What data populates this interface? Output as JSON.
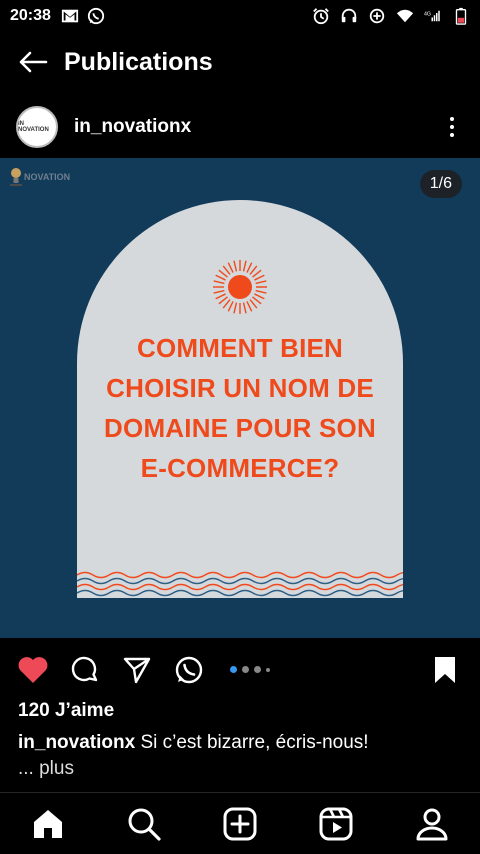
{
  "status_bar": {
    "time": "20:38",
    "network": "4G"
  },
  "header": {
    "title": "Publications"
  },
  "post": {
    "author": "in_novationx",
    "avatar_text": "IN NOVATION",
    "brand_mark_text": "NOVATION",
    "image_counter": "1/6",
    "headline_lines": [
      "COMMENT BIEN",
      "CHOISIR UN NOM DE",
      "DOMAINE POUR SON",
      "E-COMMERCE?"
    ],
    "colors": {
      "background": "#123a59",
      "arch": "#d5d9dc",
      "accent": "#ef4a1c",
      "like": "#ed4956"
    },
    "likes": "120 J’aime",
    "caption_user": "in_novationx",
    "caption_text": "Si c’est bizarre, écris-nous!",
    "more_link": "... plus"
  },
  "icons": {
    "status_left": [
      "gmail-icon",
      "whatsapp-icon"
    ],
    "status_right": [
      "alarm-icon",
      "headset-icon",
      "data-saver-icon",
      "wifi-icon",
      "signal-icon",
      "battery-icon"
    ],
    "actions": [
      "heart-icon",
      "comment-icon",
      "share-icon",
      "whatsapp-icon",
      "bookmark-icon"
    ],
    "nav": [
      "home-icon",
      "search-icon",
      "add-icon",
      "reels-icon",
      "profile-icon"
    ]
  }
}
